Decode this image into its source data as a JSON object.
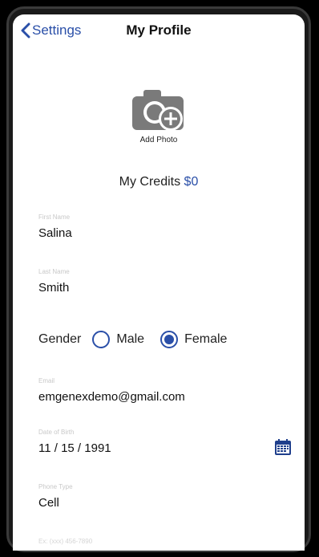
{
  "nav": {
    "back_label": "Settings",
    "title": "My Profile"
  },
  "photo": {
    "label": "Add Photo",
    "icon": "camera-plus-icon"
  },
  "credits": {
    "label": "My Credits",
    "amount": "$0"
  },
  "fields": {
    "first_name": {
      "label": "First Name",
      "value": "Salina"
    },
    "last_name": {
      "label": "Last Name",
      "value": "Smith"
    },
    "email": {
      "label": "Email",
      "value": "emgenexdemo@gmail.com"
    },
    "dob": {
      "label": "Date of Birth",
      "value": "11 / 15 / 1991"
    },
    "phone_type": {
      "label": "Phone Type",
      "value": "Cell"
    },
    "phone": {
      "label": "Ex: (xxx) 456-7890"
    }
  },
  "gender": {
    "label": "Gender",
    "options": [
      "Male",
      "Female"
    ],
    "selected": "Female"
  },
  "colors": {
    "accent": "#2a4fa8",
    "field_label": "#c8c8c8"
  }
}
